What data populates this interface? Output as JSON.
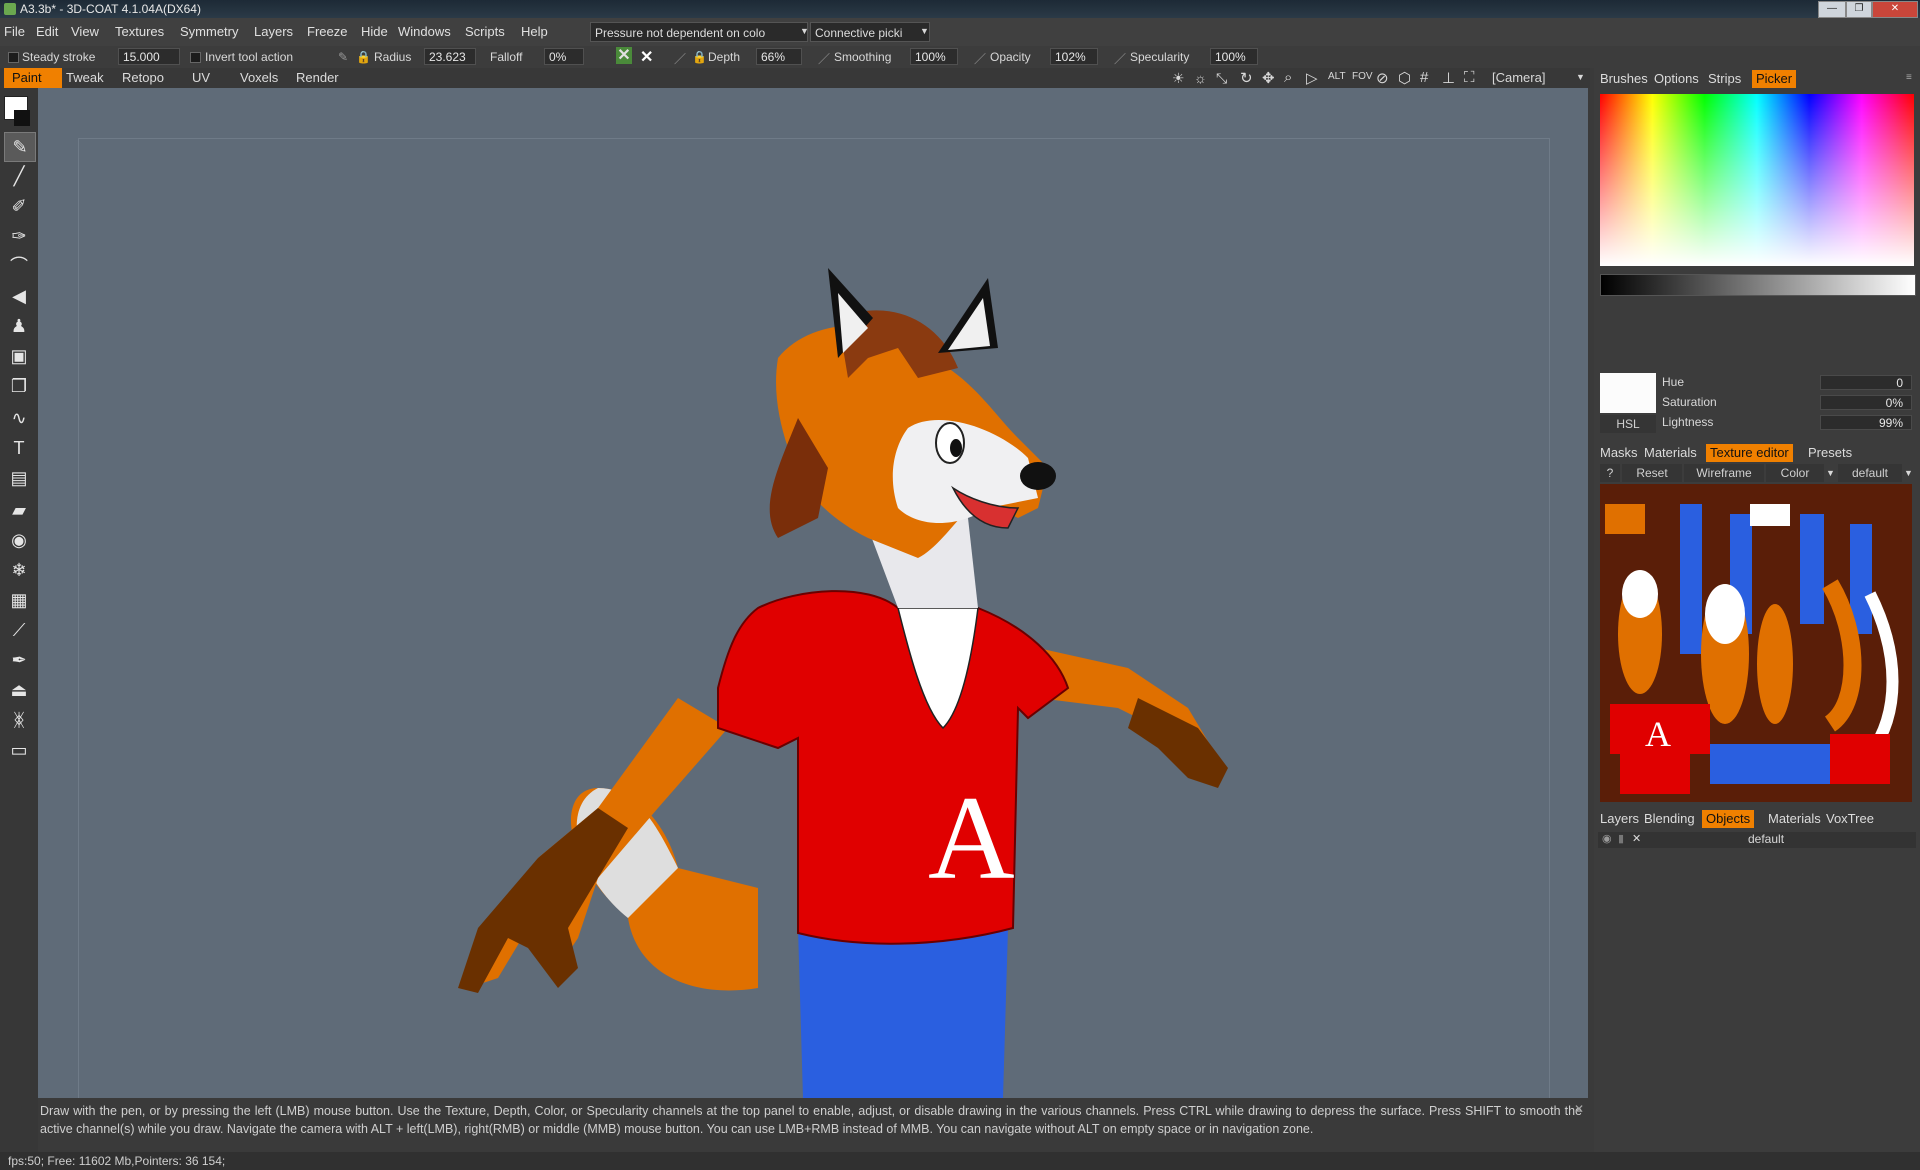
{
  "window": {
    "title": "A3.3b* - 3D-COAT 4.1.04A(DX64)"
  },
  "menu": [
    "File",
    "Edit",
    "View",
    "Textures",
    "Symmetry",
    "Layers",
    "Freeze",
    "Hide",
    "Windows",
    "Scripts",
    "Help"
  ],
  "dropdowns": {
    "pressure": "Pressure  not  dependent  on  colo",
    "picking": "Connective  picki"
  },
  "options": {
    "steady_stroke_label": "Steady  stroke",
    "steady_stroke_value": "15.000",
    "invert_label": "Invert  tool  action",
    "radius_label": "Radius",
    "radius_value": "23.623",
    "falloff_label": "Falloff",
    "falloff_value": "0%",
    "depth_label": "Depth",
    "depth_value": "66%",
    "smoothing_label": "Smoothing",
    "smoothing_value": "100%",
    "opacity_label": "Opacity",
    "opacity_value": "102%",
    "specularity_label": "Specularity",
    "specularity_value": "100%"
  },
  "rooms": [
    "Paint",
    "Tweak",
    "Retopo",
    "UV",
    "Voxels",
    "Render"
  ],
  "active_room": "Paint",
  "camera": "[Camera]",
  "right_tabs_top": [
    "Brushes",
    "Options",
    "Strips",
    "Picker"
  ],
  "active_right_tab_top": "Picker",
  "picker": {
    "mode": "HSL",
    "hue_label": "Hue",
    "hue_value": "0",
    "saturation_label": "Saturation",
    "saturation_value": "0%",
    "lightness_label": "Lightness",
    "lightness_value": "99%",
    "current_color": "#fcfcfc"
  },
  "right_tabs_mid": [
    "Masks",
    "Materials",
    "Texture  editor",
    "Presets"
  ],
  "active_right_tab_mid": "Texture  editor",
  "texture_editor": {
    "help": "?",
    "reset": "Reset",
    "wireframe": "Wireframe",
    "channel": "Color",
    "object": "default"
  },
  "right_tabs_bottom": [
    "Layers",
    "Blending",
    "Objects",
    "Materials",
    "VoxTree"
  ],
  "active_right_tab_bottom": "Objects",
  "objects": [
    {
      "name": "default"
    }
  ],
  "hint": "Draw  with  the  pen,  or  by  pressing  the  left  (LMB)  mouse  button.  Use  the  Texture,  Depth,  Color,  or  Specularity  channels  at  the  top  panel  to  enable,  adjust,  or  disable  drawing  in  the  various  channels.  Press  CTRL  while  drawing  to  depress  the  surface.  Press  SHIFT  to  smooth  the  active  channel(s)  while  you  draw.  Navigate  the  camera  with  ALT  +  left(LMB),  right(RMB)   or  middle  (MMB)  mouse  button.  You  can  use  LMB+RMB  instead  of  MMB.  You  can  navigate  without  ALT  on  empty  space  or  in  navigation  zone.",
  "status": "fps:50;     Free: 11602 Mb,Pointers: 36 154;",
  "colors": {
    "accent": "#f08000",
    "viewport_bg": "#5f6b78",
    "shirt": "#e00000",
    "fur_orange": "#e87500",
    "jeans": "#2a5fe0"
  },
  "icons": [
    "paint-brush-icon",
    "line-icon",
    "airbrush-icon",
    "fill-icon",
    "smudge-icon",
    "clone-icon",
    "stamp-icon",
    "frame-icon",
    "copy-icon",
    "spline-icon",
    "text-icon",
    "pages-icon",
    "eraser-icon",
    "eye-icon",
    "snowflake-icon",
    "ruler-icon",
    "eyedropper-icon",
    "pen-icon",
    "iron-icon",
    "butterfly-icon",
    "measure-icon"
  ]
}
